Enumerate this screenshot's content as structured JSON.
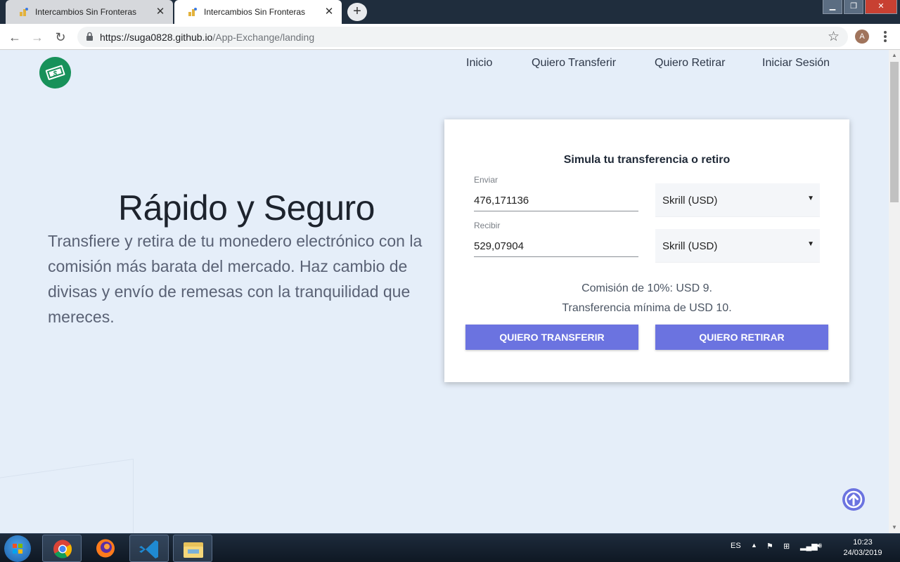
{
  "browser": {
    "tabs": [
      {
        "title": "Intercambios Sin Fronteras",
        "active": false
      },
      {
        "title": "Intercambios Sin Fronteras",
        "active": true
      }
    ],
    "url_host": "https://suga0828.github.io",
    "url_path": "/App-Exchange/landing",
    "profile_initial": "A"
  },
  "page": {
    "nav": [
      "Inicio",
      "Quiero Transferir",
      "Quiero Retirar",
      "Iniciar Sesión"
    ],
    "hero_title": "Rápido y Seguro",
    "hero_text": "Transfiere y retira de tu monedero electrónico con la comisión más barata del mercado. Haz cambio de divisas y envío de remesas con la tranquilidad que mereces.",
    "simulator": {
      "title": "Simula tu transferencia o retiro",
      "send_label": "Enviar",
      "send_value": "476,171136",
      "send_currency": "Skrill (USD)",
      "receive_label": "Recibir",
      "receive_value": "529,07904",
      "receive_currency": "Skrill (USD)",
      "commission": "Comisión de 10%: USD 9.",
      "minimum": "Transferencia mínima de USD 10.",
      "transfer_button": "QUIERO TRANSFERIR",
      "withdraw_button": "QUIERO RETIRAR"
    }
  },
  "taskbar": {
    "language": "ES",
    "time": "10:23",
    "date": "24/03/2019"
  },
  "colors": {
    "page_bg": "#e5eef9",
    "accent": "#6b73e0",
    "logo_green": "#17915a"
  }
}
